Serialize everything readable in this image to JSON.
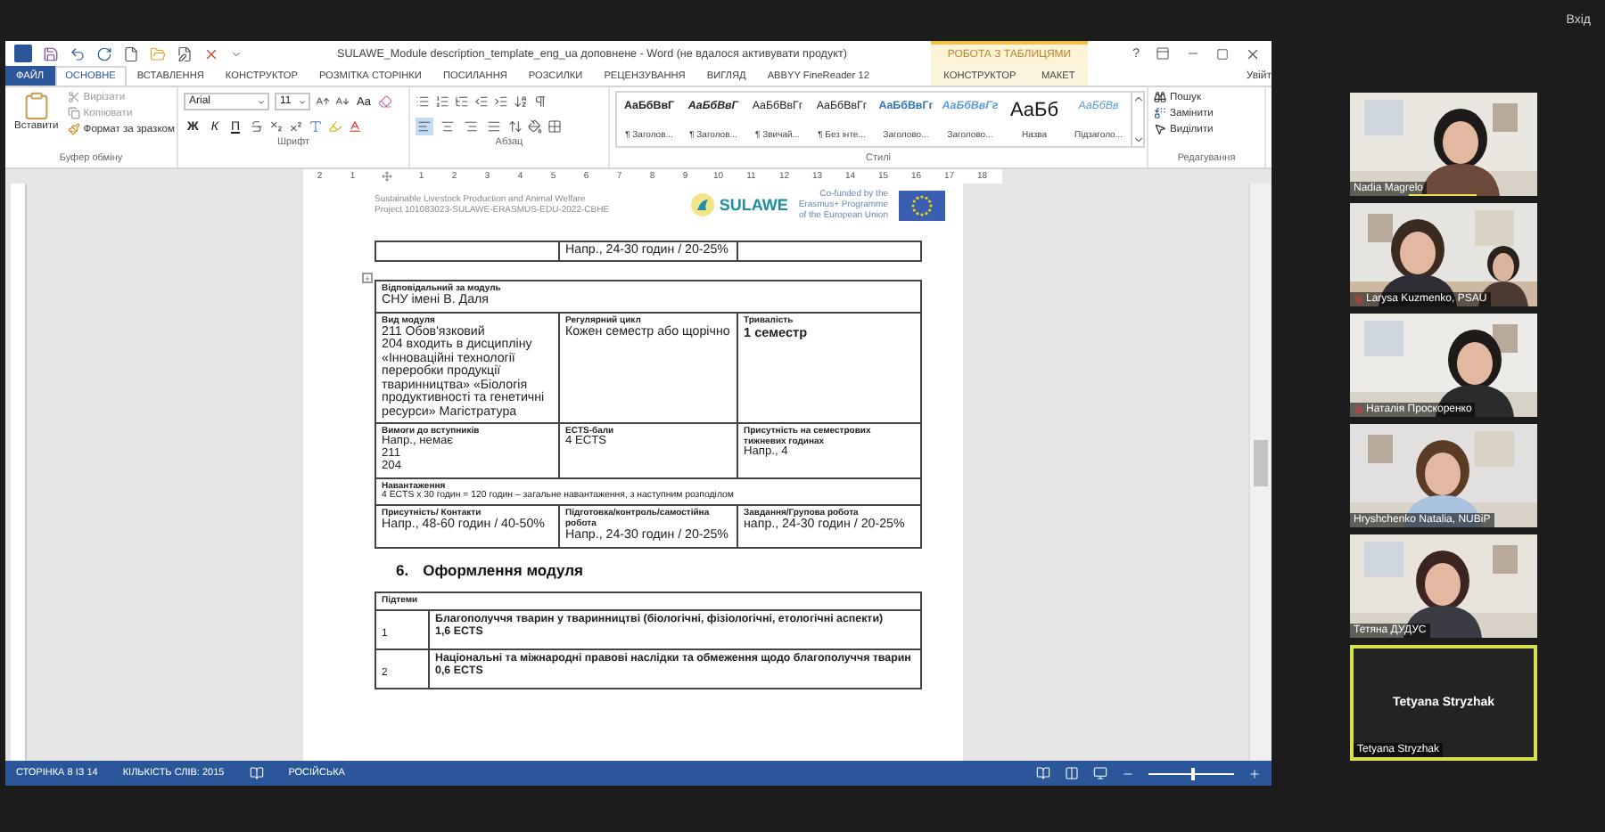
{
  "top_bar": {
    "sign_in": "Вхід"
  },
  "word": {
    "title": "SULAWE_Module description_template_eng_ua доповнене - Word (не вдалося активувати продукт)",
    "context_label": "РОБОТА З ТАБЛИЦЯМИ",
    "help": "?",
    "tabs": [
      {
        "label": "ФАЙЛ",
        "kind": "file",
        "selected": false
      },
      {
        "label": "ОСНОВНЕ",
        "kind": "tab",
        "selected": true
      },
      {
        "label": "ВСТАВЛЕННЯ",
        "kind": "tab",
        "selected": false
      },
      {
        "label": "КОНСТРУКТОР",
        "kind": "tab",
        "selected": false
      },
      {
        "label": "РОЗМІТКА СТОРІНКИ",
        "kind": "tab",
        "selected": false
      },
      {
        "label": "ПОСИЛАННЯ",
        "kind": "tab",
        "selected": false
      },
      {
        "label": "РОЗСИЛКИ",
        "kind": "tab",
        "selected": false
      },
      {
        "label": "РЕЦЕНЗУВАННЯ",
        "kind": "tab",
        "selected": false
      },
      {
        "label": "ВИГЛЯД",
        "kind": "tab",
        "selected": false
      },
      {
        "label": "ABBYY FineReader 12",
        "kind": "tab",
        "selected": false
      }
    ],
    "context_tabs": [
      {
        "label": "КОНСТРУКТОР",
        "selected": false
      },
      {
        "label": "МАКЕТ",
        "selected": false
      }
    ],
    "account": "Увійт",
    "clipboard": {
      "paste": "Вставити",
      "group": "Буфер обміну",
      "items": [
        {
          "label": "Вирізати",
          "disabled": true
        },
        {
          "label": "Копіювати",
          "disabled": true
        },
        {
          "label": "Формат за зразком",
          "disabled": false
        }
      ]
    },
    "font": {
      "name": "Arial",
      "size": "11",
      "case": "Аа",
      "styles": [
        "Ж",
        "К",
        "П"
      ],
      "group": "Шрифт"
    },
    "paragraph": {
      "group": "Абзац",
      "alignment": [
        {
          "selected": true
        },
        {
          "selected": false
        },
        {
          "selected": false
        },
        {
          "selected": false
        }
      ]
    },
    "styles": {
      "group": "Стилі",
      "items": [
        {
          "sample": "АаБбВвГ",
          "label": "¶ Заголов...",
          "kind": "bold"
        },
        {
          "sample": "АаБбВвГ",
          "label": "¶ Заголов...",
          "kind": "emphasis"
        },
        {
          "sample": "АаБбВвГг",
          "label": "¶ Звичай...",
          "kind": "normal"
        },
        {
          "sample": "АаБбВвГг",
          "label": "¶ Без інте...",
          "kind": "normal"
        },
        {
          "sample": "АаБбВвГг",
          "label": "Заголово...",
          "kind": "heading"
        },
        {
          "sample": "АаБбВвГг",
          "label": "Заголово...",
          "kind": "subheading"
        },
        {
          "sample": "АаБб",
          "label": "Назва",
          "kind": "title"
        },
        {
          "sample": "АаБбВв",
          "label": "Підзаголо...",
          "kind": "subtitle"
        }
      ]
    },
    "editing": {
      "group": "Редагування",
      "items": [
        "Пошук",
        "Замінити",
        "Виділити"
      ]
    },
    "ruler": [
      "2",
      "1",
      "1",
      "2",
      "3",
      "4",
      "5",
      "6",
      "7",
      "8",
      "9",
      "10",
      "11",
      "12",
      "13",
      "14",
      "15",
      "16",
      "17",
      "18"
    ],
    "document": {
      "header": {
        "lines": [
          "Sustainable Livestock Production and Animal Welfare",
          "Project 101083023-SULAWE-ERASMUS-EDU-2022-CBHE"
        ],
        "logo": "SULAWE",
        "cofunded": [
          "Co-funded by the",
          "Erasmus+ Programme",
          "of the European Union"
        ]
      },
      "prev_table": {
        "middle": "Напр., 24-30 годин / 20-25%"
      },
      "module_table": [
        [
          {
            "label": "Відповідальний за модуль",
            "lines": [
              "СНУ імені В. Даля"
            ],
            "kind": "normal"
          }
        ],
        [
          {
            "label": "Вид модуля",
            "lines": [
              "211 Обов'язковий",
              "204 входить в дисципліну «Інноваційні технології переробки продукції тваринництва» «Біологія продуктивності та генетичні ресурси» Магістратура"
            ],
            "kind": "normal"
          },
          {
            "label": "Регулярний цикл",
            "lines": [
              "Кожен семестр або щорічно"
            ],
            "kind": "normal"
          },
          {
            "label": "Тривалість",
            "lines": [
              "1 семестр"
            ],
            "kind": "bold"
          }
        ],
        [
          {
            "label": "Вимоги до вступників",
            "lines": [
              "Напр., немає",
              "211",
              "204"
            ],
            "kind": "medium"
          },
          {
            "label": "ECTS-бали",
            "lines": [
              "4 ECTS"
            ],
            "kind": "medium"
          },
          {
            "label": "Присутність на семестрових тижневих годинах",
            "lines": [
              "Напр., 4"
            ],
            "kind": "medium"
          }
        ],
        [
          {
            "label": "Навантаження",
            "lines": [
              "4 ECTS x 30 годин = 120 годин – загальне навантаження, з наступним розподілом"
            ],
            "kind": "small"
          }
        ],
        [
          {
            "label": "Присутність/ Контакти",
            "lines": [
              "Напр., 48-60 годин / 40-50%"
            ],
            "kind": "normal"
          },
          {
            "label": "Підготовка/контроль/самостійна робота",
            "lines": [
              "Напр., 24-30 годин / 20-25%"
            ],
            "kind": "normal"
          },
          {
            "label": "Завдання/Групова робота",
            "lines": [
              "напр., 24-30 годин / 20-25%"
            ],
            "kind": "normal"
          }
        ]
      ],
      "section": {
        "number": "6.",
        "title": "Оформлення модуля"
      },
      "topics": {
        "header": "Підтеми",
        "rows": [
          {
            "number": "1",
            "title": "Благополуччя тварин у тваринництві (біологічні, фізіологічні, етологічні аспекти)",
            "credits": "1,6 ECTS"
          },
          {
            "number": "2",
            "title": "Національні та міжнародні правові наслідки та обмеження щодо благополуччя тварин",
            "credits": "0,6 ECTS"
          }
        ]
      }
    },
    "status": {
      "page": "СТОРІНКА 8 ІЗ 14",
      "words": "КІЛЬКІСТЬ СЛІВ: 2015",
      "language": "РОСІЙСЬКА",
      "zoom": {
        "level": 0.5
      }
    }
  },
  "participants": [
    {
      "name": "Nadia Magrelo",
      "kind": "video",
      "muted": false,
      "speaking": true,
      "highlighted": false
    },
    {
      "name": "Larysa Kuzmenko, PSAU",
      "kind": "video",
      "muted": true,
      "speaking": false,
      "highlighted": false
    },
    {
      "name": "Наталія Проскоренко",
      "kind": "video",
      "muted": true,
      "speaking": false,
      "highlighted": false
    },
    {
      "name": "Hryshchenko Natalia, NUBiP",
      "kind": "video",
      "muted": false,
      "speaking": false,
      "highlighted": false
    },
    {
      "name": "Тетяна ДУДУС",
      "kind": "video",
      "muted": false,
      "speaking": false,
      "highlighted": false
    },
    {
      "name": "Tetyana Stryzhak",
      "kind": "avatar",
      "display_name": "Tetyana Stryzhak",
      "muted": false,
      "speaking": false,
      "highlighted": true
    }
  ]
}
